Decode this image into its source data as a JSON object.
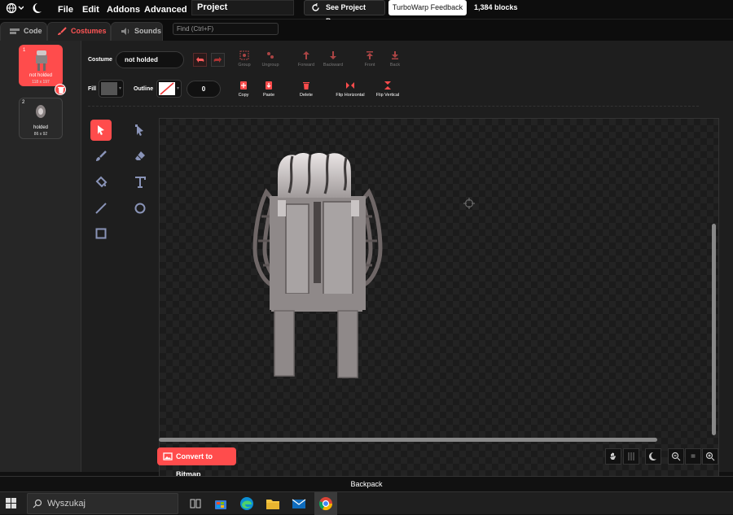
{
  "menubar": {
    "items": [
      "File",
      "Edit",
      "Addons",
      "Advanced"
    ],
    "project_title": "Project",
    "see_project_page": "See Project Page",
    "feedback": "TurboWarp Feedback",
    "block_count": "1,384 blocks"
  },
  "tabs": [
    {
      "label": "Code",
      "icon": "code-icon"
    },
    {
      "label": "Costumes",
      "icon": "brush-icon",
      "active": true
    },
    {
      "label": "Sounds",
      "icon": "speaker-icon"
    }
  ],
  "find": {
    "placeholder": "Find (Ctrl+F)"
  },
  "costumes": [
    {
      "number": "1",
      "name": "not holded",
      "size": "118 x 197",
      "selected": true
    },
    {
      "number": "2",
      "name": "holded",
      "size": "86 x 92",
      "selected": false
    }
  ],
  "editor": {
    "costume_label": "Costume",
    "costume_name": "not holded",
    "fill_label": "Fill",
    "fill_color": "#555555",
    "outline_label": "Outline",
    "outline_width": "0",
    "row1": {
      "group": "Group",
      "ungroup": "Ungroup",
      "forward": "Forward",
      "backward": "Backward",
      "front": "Front",
      "back": "Back"
    },
    "row2": {
      "copy": "Copy",
      "paste": "Paste",
      "delete": "Delete",
      "flip_h": "Flip Horizontal",
      "flip_v": "Flip Vertical"
    },
    "convert": "Convert to Bitmap",
    "zoom_equals": "="
  },
  "tools": [
    "select-tool",
    "reshape-tool",
    "brush-tool",
    "eraser-tool",
    "fill-tool",
    "text-tool",
    "line-tool",
    "circle-tool",
    "rectangle-tool"
  ],
  "backpack": "Backpack",
  "taskbar": {
    "search": "Wyszukaj"
  },
  "colors": {
    "accent": "#ff4c4c",
    "bg": "#1e1e1e",
    "panel": "#262626"
  }
}
